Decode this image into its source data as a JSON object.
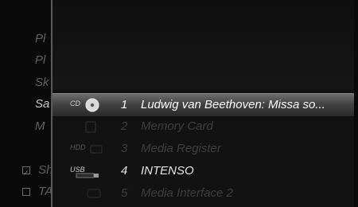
{
  "left_menu": {
    "items": [
      {
        "label": "Pl"
      },
      {
        "label": "Pl"
      },
      {
        "label": "Sk"
      },
      {
        "label": "Sa"
      },
      {
        "label": "M"
      },
      {
        "label": "Sh"
      },
      {
        "label": "TA"
      }
    ]
  },
  "media_list": {
    "items": [
      {
        "number": "1",
        "label": "Ludwig van Beethoven: Missa so...",
        "icon": "cd-icon",
        "icon_text": "CD"
      },
      {
        "number": "2",
        "label": "Memory Card",
        "icon": "memory-card-icon",
        "icon_text": ""
      },
      {
        "number": "3",
        "label": "Media Register",
        "icon": "hdd-icon",
        "icon_text": "HDD"
      },
      {
        "number": "4",
        "label": "INTENSO",
        "icon": "usb-icon",
        "icon_text": "USB"
      },
      {
        "number": "5",
        "label": "Media Interface 2",
        "icon": "media-interface-icon",
        "icon_text": ""
      }
    ]
  }
}
